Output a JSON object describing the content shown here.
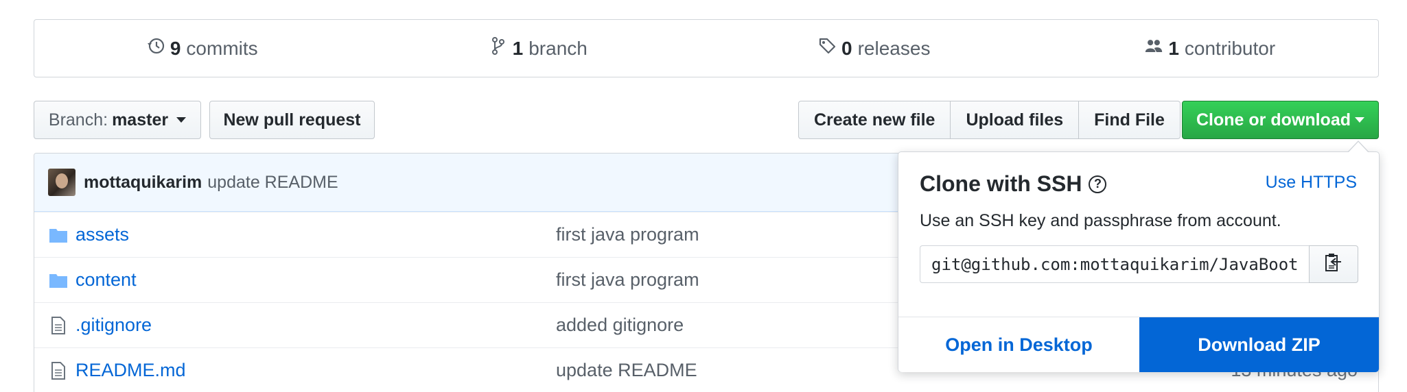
{
  "summary": {
    "commits": {
      "count": "9",
      "label": "commits",
      "icon": "history-icon"
    },
    "branches": {
      "count": "1",
      "label": "branch",
      "icon": "branch-icon"
    },
    "releases": {
      "count": "0",
      "label": "releases",
      "icon": "tag-icon"
    },
    "contributors": {
      "count": "1",
      "label": "contributor",
      "icon": "people-icon"
    }
  },
  "toolbar": {
    "branch_prefix": "Branch:",
    "branch_name": "master",
    "new_pull_request": "New pull request",
    "create_new_file": "Create new file",
    "upload_files": "Upload files",
    "find_file": "Find File",
    "clone_or_download": "Clone or download"
  },
  "latest_commit": {
    "author": "mottaquikarim",
    "message": "update README"
  },
  "files": [
    {
      "name": "assets",
      "type": "folder",
      "message": "first java program",
      "age": ""
    },
    {
      "name": "content",
      "type": "folder",
      "message": "first java program",
      "age": ""
    },
    {
      "name": ".gitignore",
      "type": "file",
      "message": "added gitignore",
      "age": ""
    },
    {
      "name": "README.md",
      "type": "file",
      "message": "update README",
      "age": "13 minutes ago"
    }
  ],
  "clone_popover": {
    "title": "Clone with SSH",
    "help_symbol": "?",
    "toggle_label": "Use HTTPS",
    "description": "Use an SSH key and passphrase from account.",
    "clone_url": "git@github.com:mottaquikarim/JavaBootcamp.git",
    "open_desktop": "Open in Desktop",
    "download_zip": "Download ZIP"
  },
  "colors": {
    "link": "#0366d6",
    "green_button": "#28a745",
    "download_button": "#0366d6",
    "commit_bar_bg": "#f1f8ff",
    "folder_icon": "#79b8ff"
  }
}
